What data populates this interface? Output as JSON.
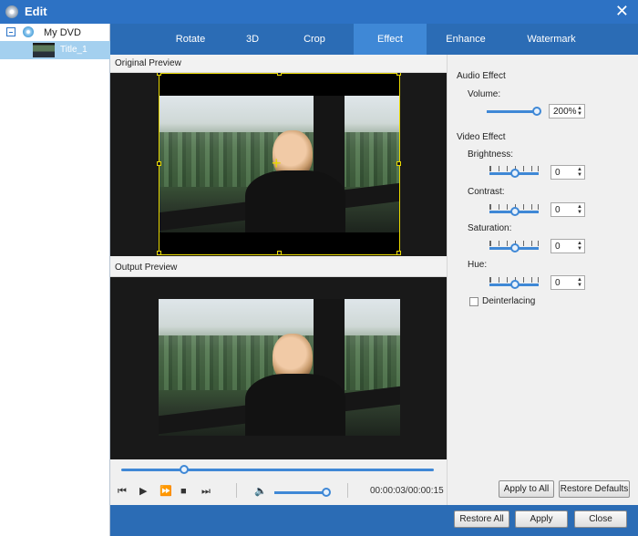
{
  "window": {
    "title": "Edit",
    "close_glyph": "✕"
  },
  "tree": {
    "root": "My DVD",
    "child": "Title_1"
  },
  "tabs": [
    {
      "label": "Rotate"
    },
    {
      "label": "3D"
    },
    {
      "label": "Crop"
    },
    {
      "label": "Effect",
      "active": true
    },
    {
      "label": "Enhance"
    },
    {
      "label": "Watermark"
    }
  ],
  "preview": {
    "original_label": "Original Preview",
    "output_label": "Output Preview",
    "crosshair_glyph": "+"
  },
  "playback": {
    "seek_fraction": 0.2,
    "volume_fraction": 1.0,
    "timecode": "00:00:03/00:00:15",
    "icons": {
      "prev": "⏮",
      "play": "▶",
      "fast_forward": "⏩",
      "stop": "■",
      "next": "⏭",
      "speaker": "🔈"
    }
  },
  "audio": {
    "section": "Audio Effect",
    "volume_label": "Volume:",
    "volume_value": "200%",
    "volume_fraction": 1.0
  },
  "video": {
    "section": "Video Effect",
    "brightness": {
      "label": "Brightness:",
      "value": "0"
    },
    "contrast": {
      "label": "Contrast:",
      "value": "0"
    },
    "saturation": {
      "label": "Saturation:",
      "value": "0"
    },
    "hue": {
      "label": "Hue:",
      "value": "0"
    },
    "deinterlacing_label": "Deinterlacing",
    "deinterlacing_checked": false
  },
  "buttons": {
    "apply_all": "Apply to All",
    "restore_defaults": "Restore Defaults",
    "restore_all": "Restore All",
    "apply": "Apply",
    "close": "Close"
  },
  "colors": {
    "accent": "#3f88d6",
    "titlebar": "#2d72c4",
    "selection": "#a4d0ef",
    "crop_frame": "#e8d800"
  }
}
